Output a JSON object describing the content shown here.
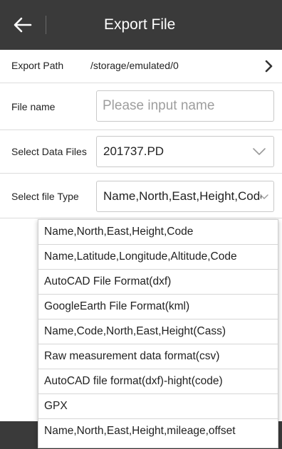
{
  "header": {
    "title": "Export File",
    "back_icon": "arrow-left-icon",
    "background": "#3a3a3a"
  },
  "export_path": {
    "label": "Export Path",
    "value": "/storage/emulated/0",
    "icon": "chevron-right-icon"
  },
  "file_name": {
    "label": "File name",
    "placeholder": "Please input name",
    "value": ""
  },
  "data_files": {
    "label": "Select Data Files",
    "selected": "201737.PD",
    "icon": "chevron-down-icon"
  },
  "file_type": {
    "label": "Select file Type",
    "selected": "Name,North,East,Height,Code",
    "icon": "chevron-down-icon",
    "options": [
      "Name,North,East,Height,Code",
      "Name,Latitude,Longitude,Altitude,Code",
      "AutoCAD File Format(dxf)",
      "GoogleEarth File Format(kml)",
      "Name,Code,North,East,Height(Cass)",
      "Raw measurement data format(csv)",
      "AutoCAD file format(dxf)-hight(code)",
      "GPX",
      "Name,North,East,Height,mileage,offset"
    ]
  }
}
